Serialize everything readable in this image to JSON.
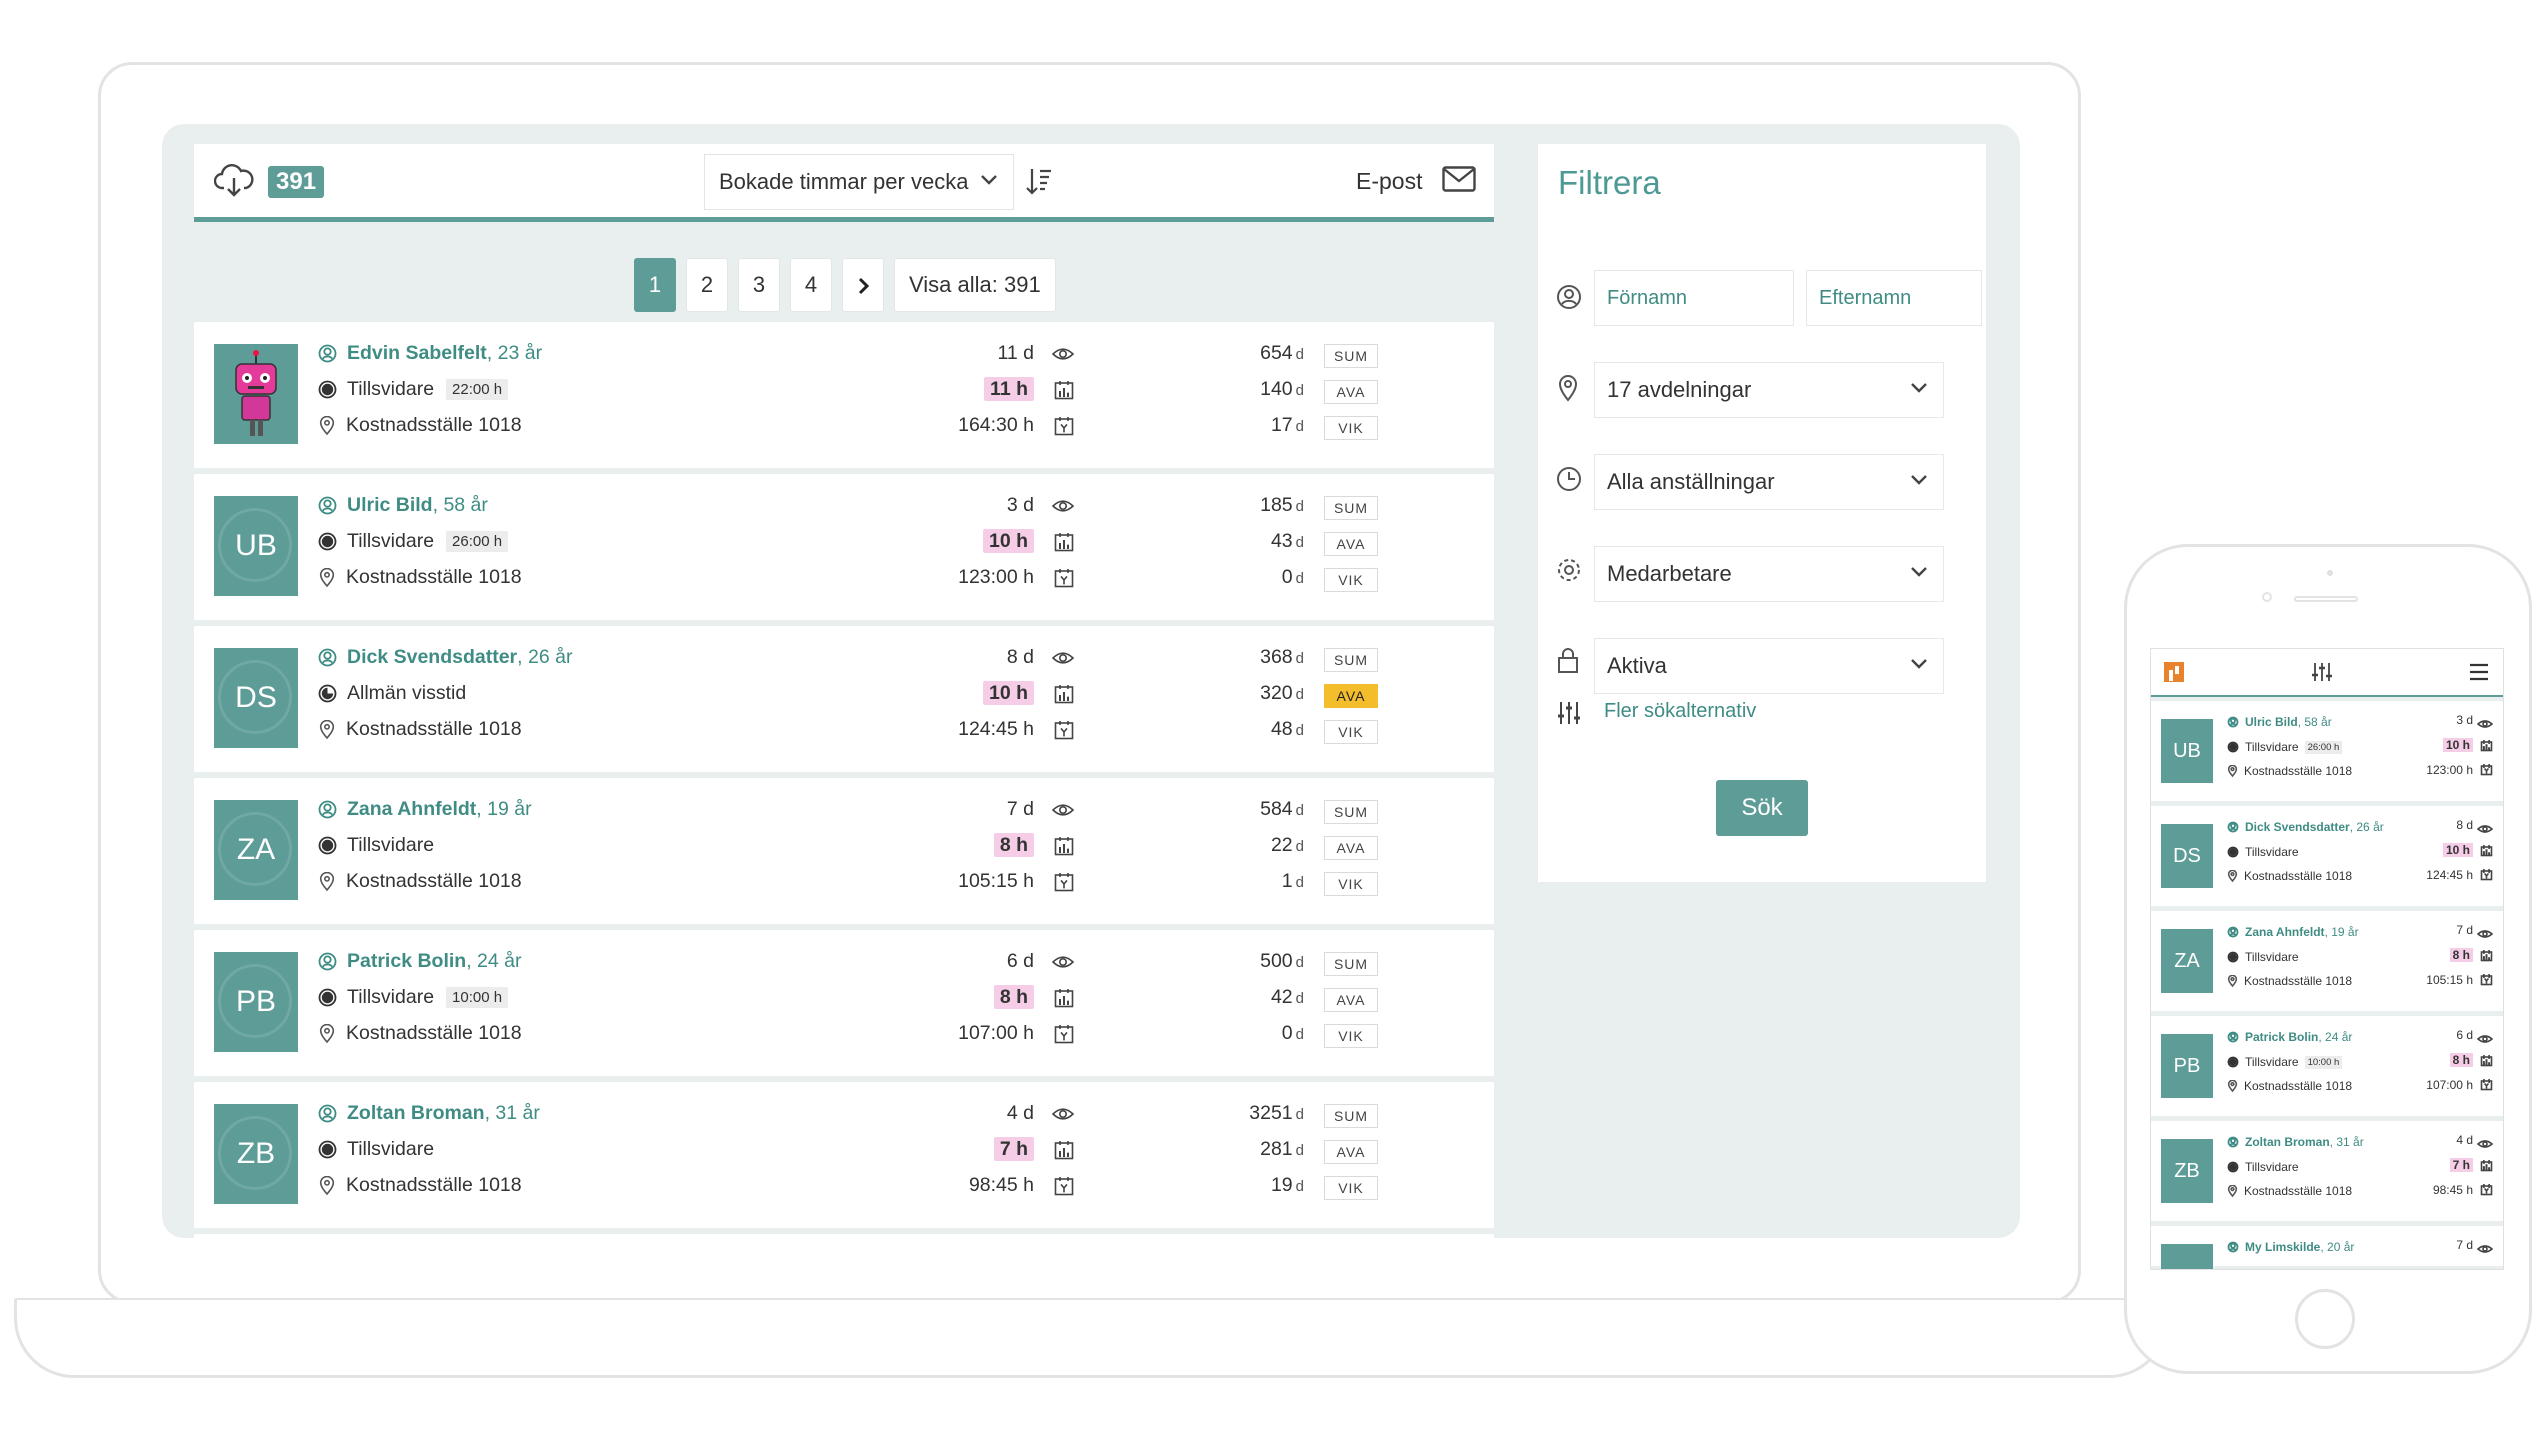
{
  "toolbar": {
    "count": "391",
    "sort_label": "Bokade timmar per vecka",
    "email_label": "E-post"
  },
  "pagination": {
    "pages": [
      "1",
      "2",
      "3",
      "4"
    ],
    "active": "1",
    "show_all": "Visa alla: 391"
  },
  "employees": [
    {
      "name": "Edvin Sabelfelt",
      "age": ", 23 år",
      "initials": "",
      "avatar": "robot",
      "role": "Tillsvidare",
      "hours_badge": "22:00 h",
      "role_icon": "filled",
      "cost": "Kostnadsställe 1018",
      "days": "11 d",
      "week_hours": "11 h",
      "total_hours": "164:30 h",
      "sum": "654",
      "ava": "140",
      "vik": "17",
      "ava_highlight": false
    },
    {
      "name": "Ulric Bild",
      "age": ", 58 år",
      "initials": "UB",
      "avatar": "initials",
      "role": "Tillsvidare",
      "hours_badge": "26:00 h",
      "role_icon": "filled",
      "cost": "Kostnadsställe 1018",
      "days": "3 d",
      "week_hours": "10 h",
      "total_hours": "123:00 h",
      "sum": "185",
      "ava": "43",
      "vik": "0",
      "ava_highlight": false
    },
    {
      "name": "Dick Svendsdatter",
      "age": ", 26 år",
      "initials": "DS",
      "avatar": "initials",
      "role": "Allmän visstid",
      "hours_badge": "",
      "role_icon": "dashed",
      "cost": "Kostnadsställe 1018",
      "days": "8 d",
      "week_hours": "10 h",
      "total_hours": "124:45 h",
      "sum": "368",
      "ava": "320",
      "vik": "48",
      "ava_highlight": true
    },
    {
      "name": "Zana Ahnfeldt",
      "age": ", 19 år",
      "initials": "ZA",
      "avatar": "initials",
      "role": "Tillsvidare",
      "hours_badge": "",
      "role_icon": "filled",
      "cost": "Kostnadsställe 1018",
      "days": "7 d",
      "week_hours": "8 h",
      "total_hours": "105:15 h",
      "sum": "584",
      "ava": "22",
      "vik": "1",
      "ava_highlight": false
    },
    {
      "name": "Patrick Bolin",
      "age": ", 24 år",
      "initials": "PB",
      "avatar": "initials",
      "role": "Tillsvidare",
      "hours_badge": "10:00 h",
      "role_icon": "filled",
      "cost": "Kostnadsställe 1018",
      "days": "6 d",
      "week_hours": "8 h",
      "total_hours": "107:00 h",
      "sum": "500",
      "ava": "42",
      "vik": "0",
      "ava_highlight": false
    },
    {
      "name": "Zoltan Broman",
      "age": ", 31 år",
      "initials": "ZB",
      "avatar": "initials",
      "role": "Tillsvidare",
      "hours_badge": "",
      "role_icon": "filled",
      "cost": "Kostnadsställe 1018",
      "days": "4 d",
      "week_hours": "7 h",
      "total_hours": "98:45 h",
      "sum": "3251",
      "ava": "281",
      "vik": "19",
      "ava_highlight": false
    }
  ],
  "tags": {
    "sum": "SUM",
    "ava": "AVA",
    "vik": "VIK",
    "day_unit": "d"
  },
  "filter": {
    "title": "Filtrera",
    "first_name_placeholder": "Förnamn",
    "last_name_placeholder": "Efternamn",
    "departments": "17 avdelningar",
    "employments": "Alla anställningar",
    "role": "Medarbetare",
    "status": "Aktiva",
    "more_options": "Fler sökalternativ",
    "search_button": "Sök"
  },
  "phone": {
    "employees": [
      {
        "name": "Ulric Bild",
        "age": ", 58 år",
        "initials": "UB",
        "role": "Tillsvidare",
        "hours_badge": "26:00 h",
        "cost": "Kostnadsställe 1018",
        "days": "3 d",
        "week_hours": "10 h",
        "total_hours": "123:00 h"
      },
      {
        "name": "Dick Svendsdatter",
        "age": ", 26 år",
        "initials": "DS",
        "role": "Tillsvidare",
        "hours_badge": "",
        "cost": "Kostnadsställe 1018",
        "days": "8 d",
        "week_hours": "10 h",
        "total_hours": "124:45 h"
      },
      {
        "name": "Zana Ahnfeldt",
        "age": ", 19 år",
        "initials": "ZA",
        "role": "Tillsvidare",
        "hours_badge": "",
        "cost": "Kostnadsställe 1018",
        "days": "7 d",
        "week_hours": "8 h",
        "total_hours": "105:15 h"
      },
      {
        "name": "Patrick Bolin",
        "age": ", 24 år",
        "initials": "PB",
        "role": "Tillsvidare",
        "hours_badge": "10:00 h",
        "cost": "Kostnadsställe 1018",
        "days": "6 d",
        "week_hours": "8 h",
        "total_hours": "107:00 h"
      },
      {
        "name": "Zoltan Broman",
        "age": ", 31 år",
        "initials": "ZB",
        "role": "Tillsvidare",
        "hours_badge": "",
        "cost": "Kostnadsställe 1018",
        "days": "4 d",
        "week_hours": "7 h",
        "total_hours": "98:45 h"
      },
      {
        "name": "My Limskilde",
        "age": ", 20 år",
        "initials": "",
        "role": "",
        "hours_badge": "",
        "cost": "",
        "days": "7 d",
        "week_hours": "",
        "total_hours": ""
      }
    ]
  },
  "colors": {
    "accent": "#5d9c97",
    "name_text": "#3f8c84",
    "pink_badge": "#f6cde7",
    "yellow_tag": "#f4bd2c",
    "screen_bg": "#e9efee"
  }
}
